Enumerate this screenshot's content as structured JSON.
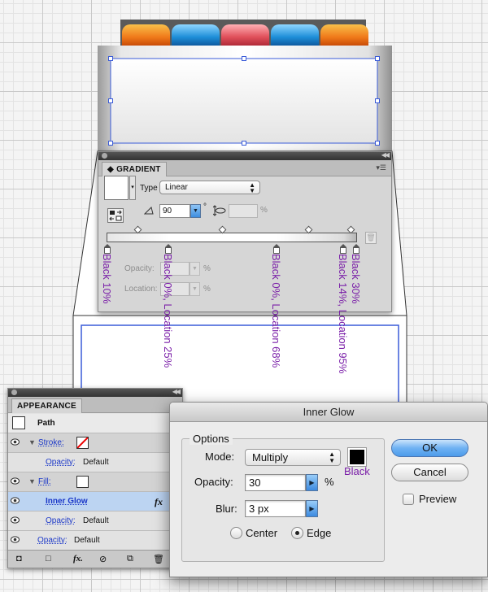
{
  "colors": {
    "accent": "#3a5bd8",
    "annotation": "#7a1ea8",
    "tab_orange": "#f07a1a",
    "tab_blue": "#1e8fd8",
    "tab_red": "#e04f5a",
    "selection": "#bcd4f2"
  },
  "gradient_panel": {
    "tab": "GRADIENT",
    "type_label": "Type",
    "type_value": "Linear",
    "angle_value": "90",
    "degree_symbol": "°",
    "aspect_unit": "%",
    "opacity_label": "Opacity:",
    "opacity_unit": "%",
    "location_label": "Location:",
    "location_unit": "%",
    "icons": [
      "reverse-gradient-icon",
      "angle-icon",
      "aspect-ratio-icon",
      "delete-stop-icon",
      "panel-menu-icon"
    ],
    "stop_annotations": [
      "Black 10%",
      "Black 0%, Location 25%",
      "Black 0%, Location 68%",
      "Black 14%, Location 95%",
      "Black 30%"
    ]
  },
  "appearance_panel": {
    "tab": "APPEARANCE",
    "object": "Path",
    "stroke_label": "Stroke:",
    "fill_label": "Fill:",
    "opacity_label": "Opacity:",
    "opacity_value": "Default",
    "effect": "Inner Glow",
    "fx_label": "fx",
    "icons": [
      "eye-icon",
      "no-color-icon",
      "fx-icon",
      "add-new-stroke-icon",
      "add-new-fill-icon",
      "clear-icon",
      "duplicate-icon",
      "trash-icon"
    ]
  },
  "inner_glow": {
    "title": "Inner Glow",
    "options_legend": "Options",
    "mode_label": "Mode:",
    "mode_value": "Multiply",
    "color_annotation": "Black",
    "opacity_label": "Opacity:",
    "opacity_value": "30",
    "opacity_unit": "%",
    "blur_label": "Blur:",
    "blur_value": "3 px",
    "center_label": "Center",
    "edge_label": "Edge",
    "edge_selected": true,
    "ok_label": "OK",
    "cancel_label": "Cancel",
    "preview_label": "Preview",
    "preview_checked": false
  }
}
